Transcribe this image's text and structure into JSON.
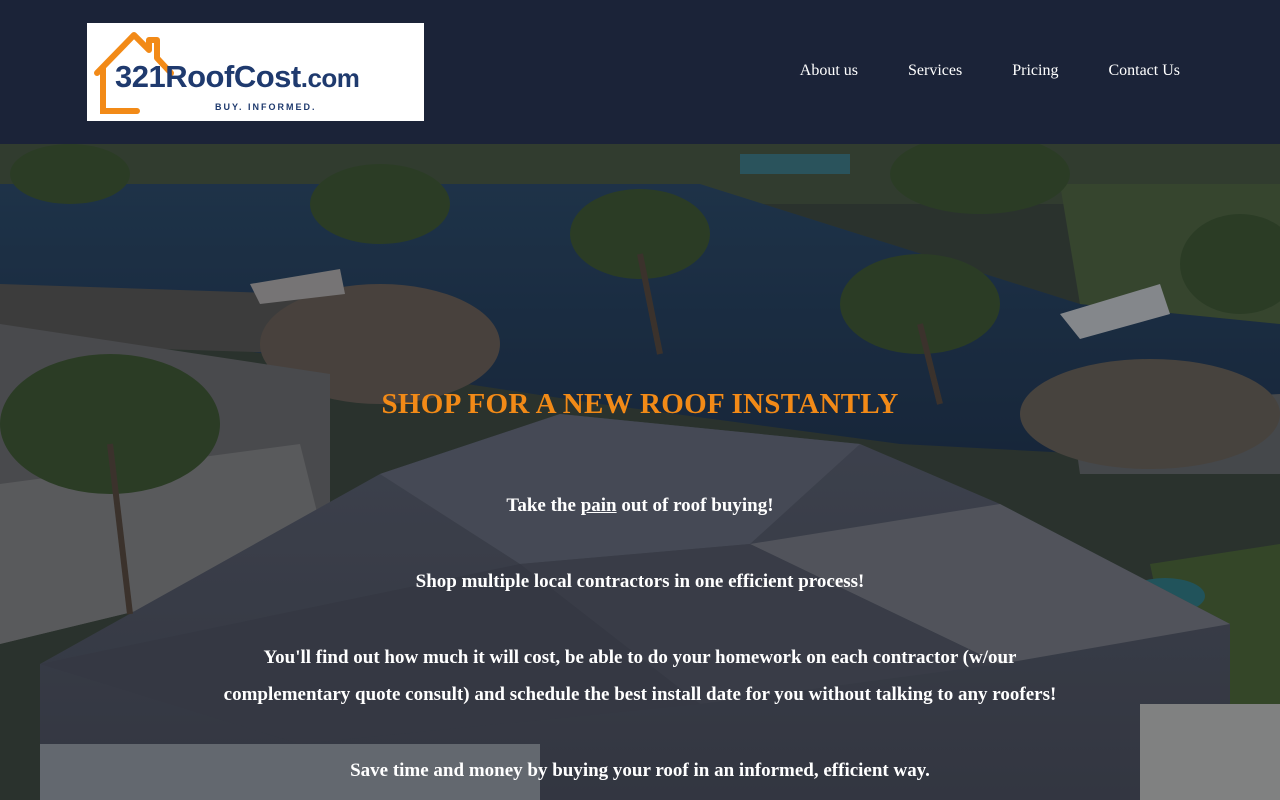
{
  "header": {
    "logo": {
      "brand_part1": "321",
      "brand_part2": "RoofCost",
      "brand_part3": ".com",
      "tagline": "BUY. INFORMED."
    },
    "nav": [
      {
        "label": "About us"
      },
      {
        "label": "Services"
      },
      {
        "label": "Pricing"
      },
      {
        "label": "Contact Us"
      }
    ]
  },
  "hero": {
    "headline": "SHOP FOR A NEW ROOF INSTANTLY",
    "p1_before": "Take the ",
    "p1_underlined": "pain",
    "p1_after": " out of roof buying!",
    "p2": "Shop multiple local contractors in one efficient process!",
    "p3_line1": "You'll find out how much it will cost, be able to do your homework on each contractor (w/our",
    "p3_line2": "complementary quote consult) and schedule the best install date for you without talking to any roofers!",
    "p4": "Save time and money by buying your roof in an informed, efficient way."
  },
  "colors": {
    "header_bg": "#1b2338",
    "headline": "#f28a17",
    "logo_text": "#1f3a6e",
    "logo_house": "#f28a17"
  },
  "icons": {
    "logo_house": "house-outline-icon"
  }
}
